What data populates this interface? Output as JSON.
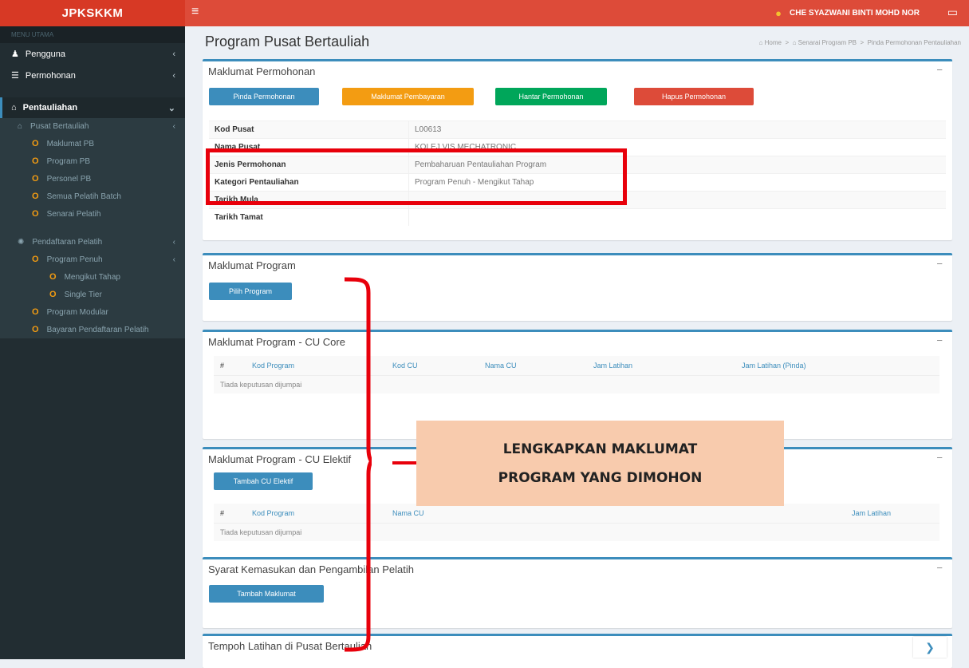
{
  "header": {
    "logo": "JPKSKKM",
    "menu_icon": "hamburger-icon",
    "user_name": "CHE SYAZWANI BINTI MOHD NOR"
  },
  "sidebar": {
    "header": "MENU UTAMA",
    "items": [
      {
        "label": "Pengguna",
        "icon": "user-icon"
      },
      {
        "label": "Permohonan",
        "icon": "list-icon"
      },
      {
        "label": "Pentauliahan",
        "icon": "bank-icon"
      }
    ],
    "pusat": {
      "label": "Pusat Bertauliah",
      "children": [
        "Maklumat PB",
        "Program PB",
        "Personel PB",
        "Semua Pelatih Batch",
        "Senarai Pelatih"
      ]
    },
    "pendaftaran": {
      "label": "Pendaftaran Pelatih",
      "program_penuh": "Program Penuh",
      "penuh_children": [
        "Mengikut Tahap",
        "Single Tier"
      ],
      "modular": "Program Modular",
      "bayaran": "Bayaran Pendaftaran Pelatih"
    }
  },
  "page": {
    "title": "Program Pusat Bertauliah",
    "breadcrumb": [
      "Home",
      "Senarai Program PB",
      "Pinda Permohonan Pentauliahan"
    ]
  },
  "maklumat_permohonan": {
    "title": "Maklumat Permohonan",
    "buttons": {
      "pinda": "Pinda Permohonan",
      "pembayaran": "Maklumat Pembayaran",
      "hantar": "Hantar Permohonan",
      "hapus": "Hapus Permohonan"
    },
    "rows": [
      {
        "key": "Kod Pusat",
        "value": "L00613"
      },
      {
        "key": "Nama Pusat",
        "value": "KOLEJ VIS MECHATRONIC"
      },
      {
        "key": "Jenis Permohonan",
        "value": "Pembaharuan Pentauliahan Program"
      },
      {
        "key": "Kategori Pentauliahan",
        "value": "Program Penuh - Mengikut Tahap"
      },
      {
        "key": "Tarikh Mula",
        "value": ""
      },
      {
        "key": "Tarikh Tamat",
        "value": ""
      }
    ]
  },
  "maklumat_program": {
    "title": "Maklumat Program",
    "button": "Pilih Program"
  },
  "cu_core": {
    "title": "Maklumat Program - CU Core",
    "columns": [
      "#",
      "Kod Program",
      "Kod CU",
      "Nama CU",
      "Jam Latihan",
      "Jam Latihan (Pinda)"
    ],
    "empty": "Tiada keputusan dijumpai"
  },
  "cu_elektif": {
    "title": "Maklumat Program - CU Elektif",
    "button": "Tambah CU Elektif",
    "columns": [
      "#",
      "Kod Program",
      "Nama CU",
      "Jam Latihan"
    ],
    "empty": "Tiada keputusan dijumpai"
  },
  "syarat": {
    "title": "Syarat Kemasukan dan Pengambilan Pelatih",
    "button": "Tambah Maklumat"
  },
  "tempoh": {
    "title": "Tempoh Latihan di Pusat Bertauliah"
  },
  "annotation": {
    "line1": "LENGKAPKAN MAKLUMAT",
    "line2": "PROGRAM YANG DIMOHON",
    "color": "#e8000b"
  },
  "box_collapse_symbol": "−"
}
